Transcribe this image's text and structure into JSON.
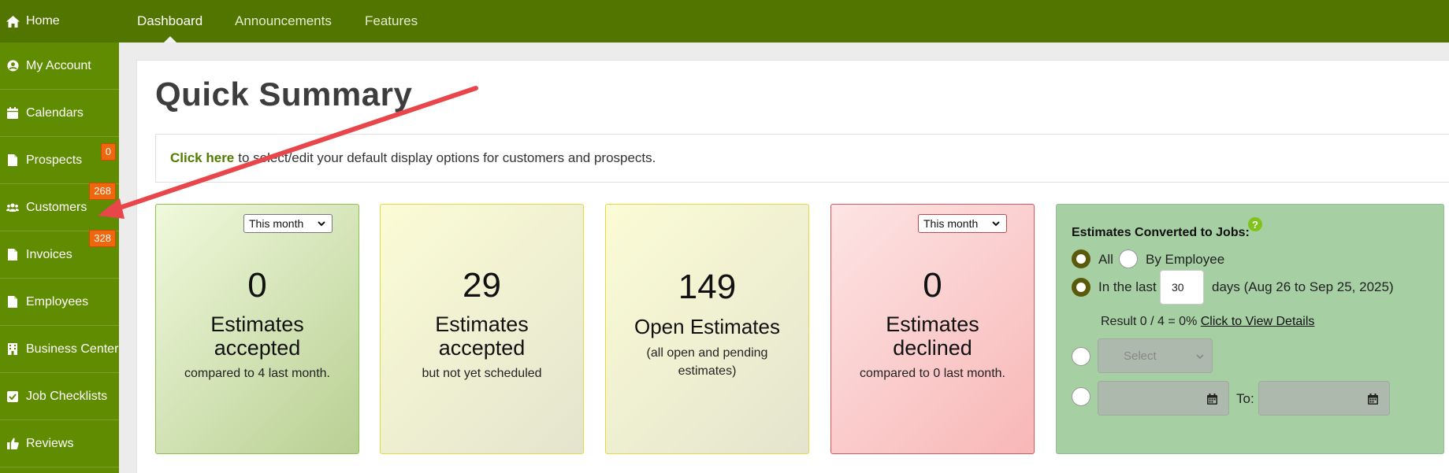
{
  "topnav": {
    "home": "Home",
    "tabs": [
      {
        "label": "Dashboard",
        "active": true
      },
      {
        "label": "Announcements",
        "active": false
      },
      {
        "label": "Features",
        "active": false
      }
    ]
  },
  "sidebar": {
    "items": [
      {
        "label": "My Account",
        "icon": "user-circle-icon"
      },
      {
        "label": "Calendars",
        "icon": "calendar-icon"
      },
      {
        "label": "Prospects",
        "icon": "file-icon",
        "badge": "0"
      },
      {
        "label": "Customers",
        "icon": "users-icon",
        "badge": "268"
      },
      {
        "label": "Invoices",
        "icon": "file-icon",
        "badge": "328"
      },
      {
        "label": "Employees",
        "icon": "file-icon"
      },
      {
        "label": "Business Center",
        "icon": "building-icon"
      },
      {
        "label": "Job Checklists",
        "icon": "checkbox-icon"
      },
      {
        "label": "Reviews",
        "icon": "thumbs-up-icon"
      }
    ]
  },
  "main": {
    "title": "Quick Summary",
    "notice_link": "Click here",
    "notice_text": "to select/edit your default display options for customers and prospects."
  },
  "cards": {
    "accepted": {
      "select": "This month",
      "value": "0",
      "label1": "Estimates",
      "label2": "accepted",
      "sub": "compared to 4 last month."
    },
    "unscheduled": {
      "value": "29",
      "label1": "Estimates",
      "label2": "accepted",
      "sub": "but not yet scheduled"
    },
    "open": {
      "value": "149",
      "label1": "Open Estimates",
      "sub1": "(all open and pending",
      "sub2": "estimates)"
    },
    "declined": {
      "select": "This month",
      "value": "0",
      "label1": "Estimates",
      "label2": "declined",
      "sub": "compared to 0 last month."
    }
  },
  "conversion": {
    "title": "Estimates Converted to Jobs:",
    "help": "?",
    "all": "All",
    "by_employee": "By Employee",
    "in_last": "In the last",
    "days_value": "30",
    "days_suffix": "days (Aug 26 to Sep 25, 2025)",
    "result": "Result 0 / 4 = 0%",
    "details_link": "Click to View Details",
    "select_placeholder": "Select",
    "to_label": "To:"
  },
  "colors": {
    "topbar": "#527500",
    "sidebar": "#5f8c00",
    "badge": "#f0660d",
    "arrow": "#e8464b"
  }
}
